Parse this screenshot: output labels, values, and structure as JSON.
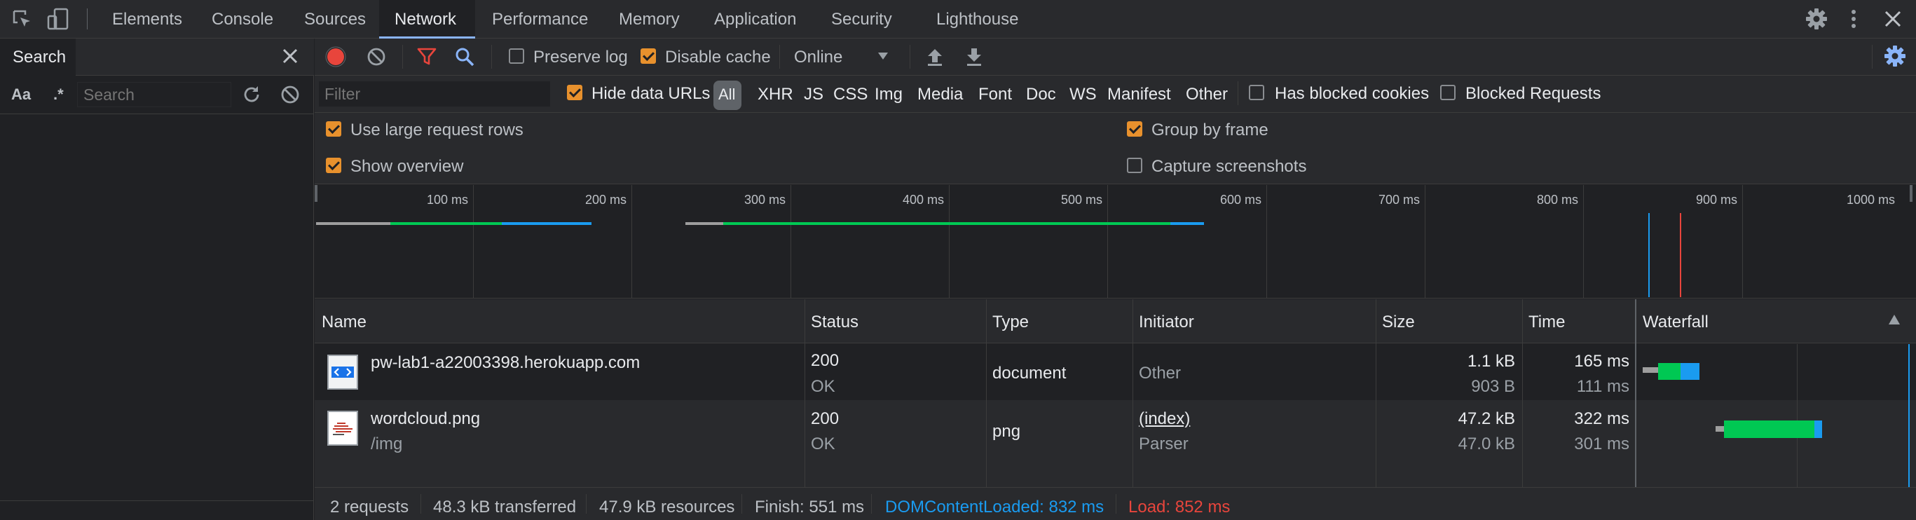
{
  "tabs": [
    "Elements",
    "Console",
    "Sources",
    "Network",
    "Performance",
    "Memory",
    "Application",
    "Security",
    "Lighthouse"
  ],
  "active_tab": "Network",
  "search_panel": {
    "title": "Search",
    "case_label": "Aa",
    "regex_label": ".*",
    "placeholder": "Search"
  },
  "toolbar": {
    "preserve_log": "Preserve log",
    "disable_cache": "Disable cache",
    "throttle": "Online"
  },
  "filter_bar": {
    "placeholder": "Filter",
    "hide_data_urls": "Hide data URLs",
    "types": [
      "All",
      "XHR",
      "JS",
      "CSS",
      "Img",
      "Media",
      "Font",
      "Doc",
      "WS",
      "Manifest",
      "Other"
    ],
    "has_blocked_cookies": "Has blocked cookies",
    "blocked_requests": "Blocked Requests"
  },
  "settings": {
    "large_rows": "Use large request rows",
    "group_by_frame": "Group by frame",
    "show_overview": "Show overview",
    "capture_screenshots": "Capture screenshots"
  },
  "overview_ticks": [
    "100 ms",
    "200 ms",
    "300 ms",
    "400 ms",
    "500 ms",
    "600 ms",
    "700 ms",
    "800 ms",
    "900 ms",
    "1000 ms"
  ],
  "columns": [
    "Name",
    "Status",
    "Type",
    "Initiator",
    "Size",
    "Time",
    "Waterfall"
  ],
  "requests": [
    {
      "name": "pw-lab1-a22003398.herokuapp.com",
      "path": "",
      "status": "200",
      "status_text": "OK",
      "type": "document",
      "initiator": "Other",
      "initiator_sub": "",
      "size": "1.1 kB",
      "size_sub": "903 B",
      "time": "165 ms",
      "time_sub": "111 ms"
    },
    {
      "name": "wordcloud.png",
      "path": "/img",
      "status": "200",
      "status_text": "OK",
      "type": "png",
      "initiator": "(index)",
      "initiator_sub": "Parser",
      "size": "47.2 kB",
      "size_sub": "47.0 kB",
      "time": "322 ms",
      "time_sub": "301 ms"
    }
  ],
  "status_bar": {
    "requests": "2 requests",
    "transferred": "48.3 kB transferred",
    "resources": "47.9 kB resources",
    "finish": "Finish: 551 ms",
    "dcl": "DOMContentLoaded: 832 ms",
    "load": "Load: 852 ms"
  },
  "colors": {
    "accent": "#8ab4f8",
    "waiting": "#00c853",
    "download": "#1a9bf0",
    "dcl": "#1a9bf0",
    "load": "#e8453c",
    "checkbox": "#e8912d"
  }
}
